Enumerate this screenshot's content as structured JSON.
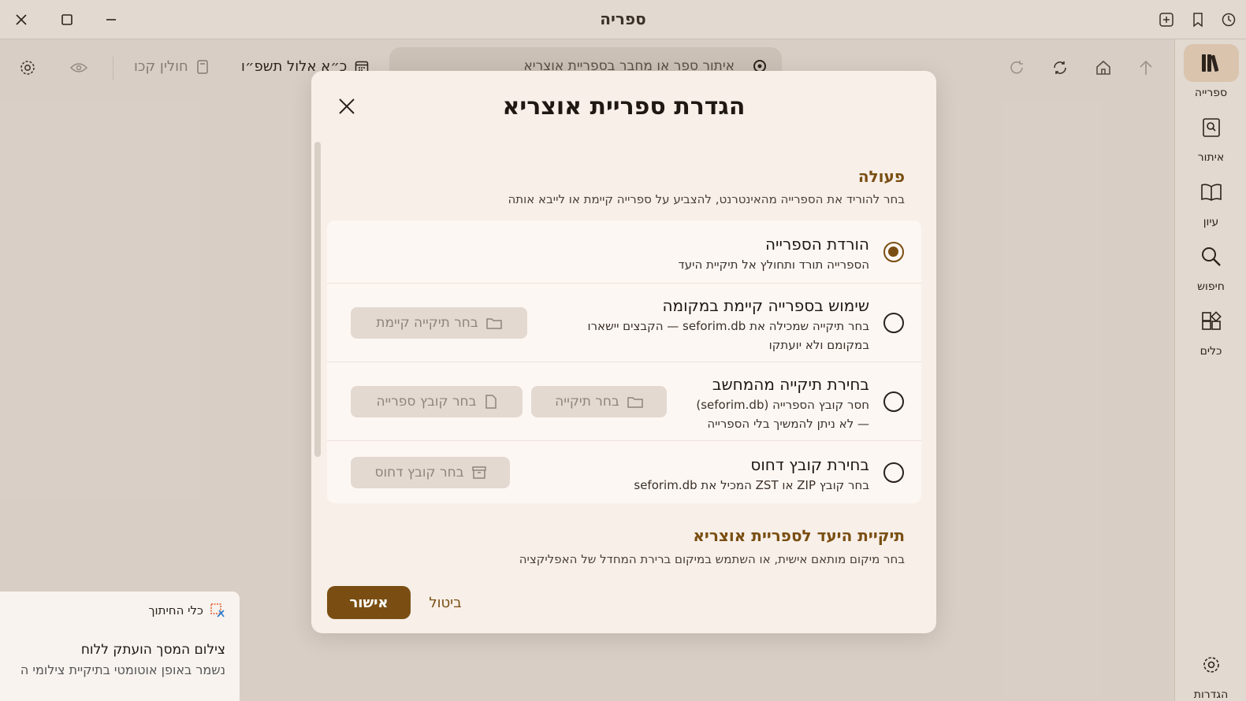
{
  "window": {
    "title": "ספריה"
  },
  "toolbar": {
    "search_text": "איתור ספר או מחבר בספריית אוצריא",
    "hebrew_date": "כ״א אלול תשפ״ו",
    "parasha": "חולין קכו"
  },
  "nav": {
    "items": [
      {
        "label": "ספרייה",
        "icon": "library-icon"
      },
      {
        "label": "איתור",
        "icon": "find-book-icon"
      },
      {
        "label": "עיון",
        "icon": "open-book-icon"
      },
      {
        "label": "חיפוש",
        "icon": "search-icon"
      },
      {
        "label": "כלים",
        "icon": "tools-icon"
      }
    ],
    "settings_label": "הגדרות"
  },
  "dialog": {
    "title": "הגדרת ספריית אוצריא",
    "action_section": {
      "title": "פעולה",
      "desc": "בחר להוריד את הספרייה מהאינטרנט, להצביע על ספרייה קיימת או לייבא אותה"
    },
    "options": [
      {
        "title": "הורדת הספרייה",
        "desc": "הספרייה תורד ותחולץ אל תיקיית היעד",
        "checked": true
      },
      {
        "title": "שימוש בספרייה קיימת במקומה",
        "desc_line1": "בחר תיקייה שמכילה את seforim.db — הקבצים יישארו",
        "desc_line2": "במקומם ולא יועתקו",
        "button": "בחר תיקייה קיימת",
        "checked": false
      },
      {
        "title": "בחירת תיקייה מהמחשב",
        "desc_line1": "חסר קובץ הספרייה (seforim.db)",
        "desc_line2": "— לא ניתן להמשיך בלי הספרייה",
        "button_folder": "בחר תיקייה",
        "button_file": "בחר קובץ ספרייה",
        "checked": false
      },
      {
        "title": "בחירת קובץ דחוס",
        "desc": "בחר קובץ ZIP או ZST המכיל את seforim.db",
        "button": "בחר קובץ דחוס",
        "checked": false
      }
    ],
    "target_section": {
      "title": "תיקיית היעד לספריית אוצריא",
      "desc": "בחר מיקום מותאם אישית, או השתמש במיקום ברירת המחדל של האפליקציה"
    },
    "ok_label": "אישור",
    "cancel_label": "ביטול"
  },
  "toast": {
    "app": "כלי החיתוך",
    "message": "צילום המסך הועתק ללוח",
    "sub": "נשמר באופן אוטומטי בתיקיית צילומי ה"
  },
  "colors": {
    "accent": "#7a4e12",
    "background": "#e5dbd3",
    "dialog": "#f7efe8"
  }
}
